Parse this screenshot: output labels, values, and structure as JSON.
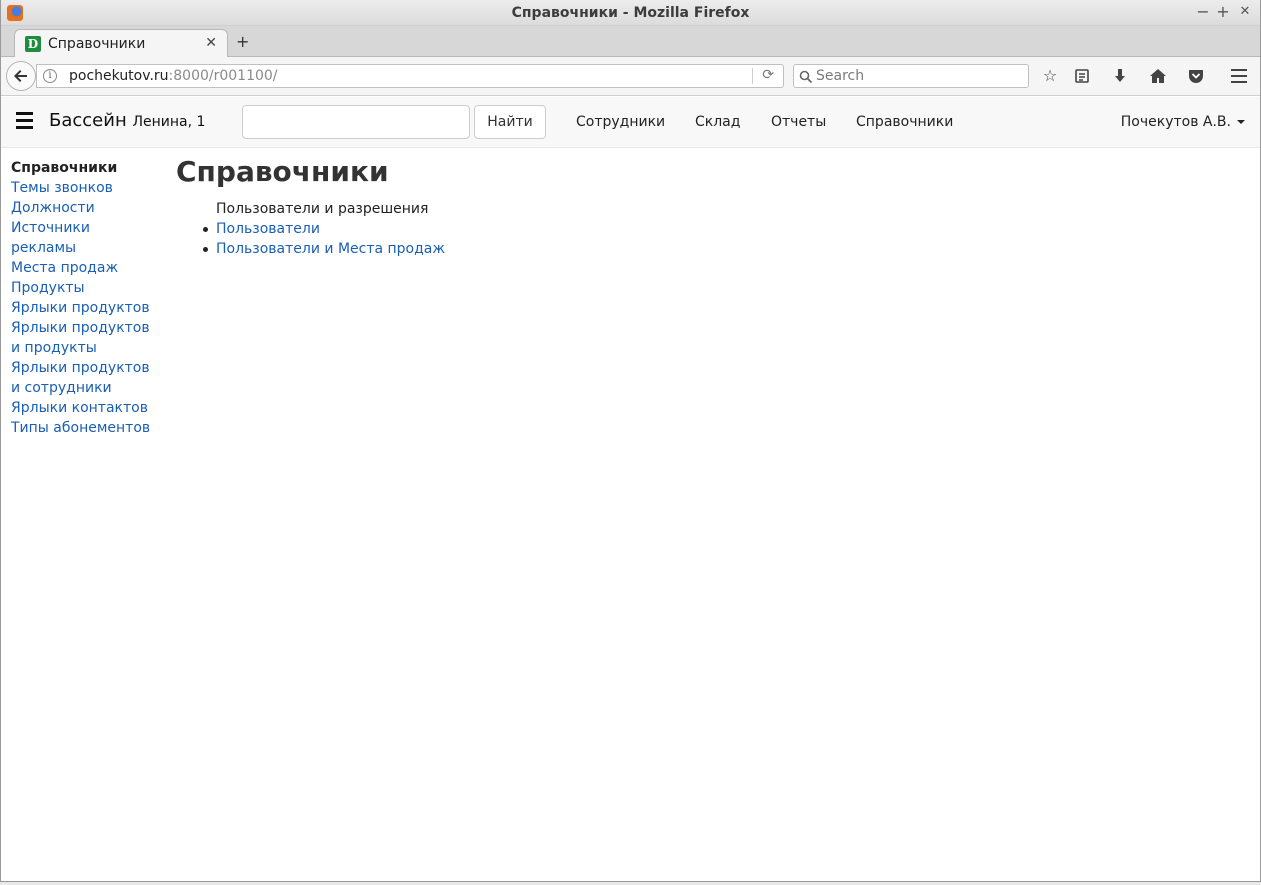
{
  "window": {
    "title": "Справочники - Mozilla Firefox",
    "minimize": "−",
    "maximize": "+",
    "close": "✕"
  },
  "browser": {
    "tab_title": "Справочники",
    "tab_favicon": "D",
    "tab_close": "✕",
    "new_tab": "+",
    "url_host": "pochekutov.ru",
    "url_rest": ":8000/r001100/",
    "search_placeholder": "Search"
  },
  "header": {
    "brand": "Бассейн",
    "brand_sub": "Ленина, 1",
    "search_value": "",
    "find_button": "Найти",
    "nav": [
      "Сотрудники",
      "Склад",
      "Отчеты",
      "Справочники"
    ],
    "user": "Почекутов А.В."
  },
  "sidebar": {
    "title": "Справочники",
    "items": [
      "Темы звонков",
      "Должности",
      "Источники рекламы",
      "Места продаж",
      "Продукты",
      "Ярлыки продуктов",
      "Ярлыки продуктов и продукты",
      "Ярлыки продуктов и сотрудники",
      "Ярлыки контактов",
      "Типы абонементов"
    ]
  },
  "main": {
    "title": "Справочники",
    "group_label": "Пользователи и разрешения",
    "links": [
      "Пользователи",
      "Пользователи и Места продаж"
    ]
  },
  "colors": {
    "link": "#1a5fb4",
    "favicon_bg": "#1e8e3e"
  }
}
